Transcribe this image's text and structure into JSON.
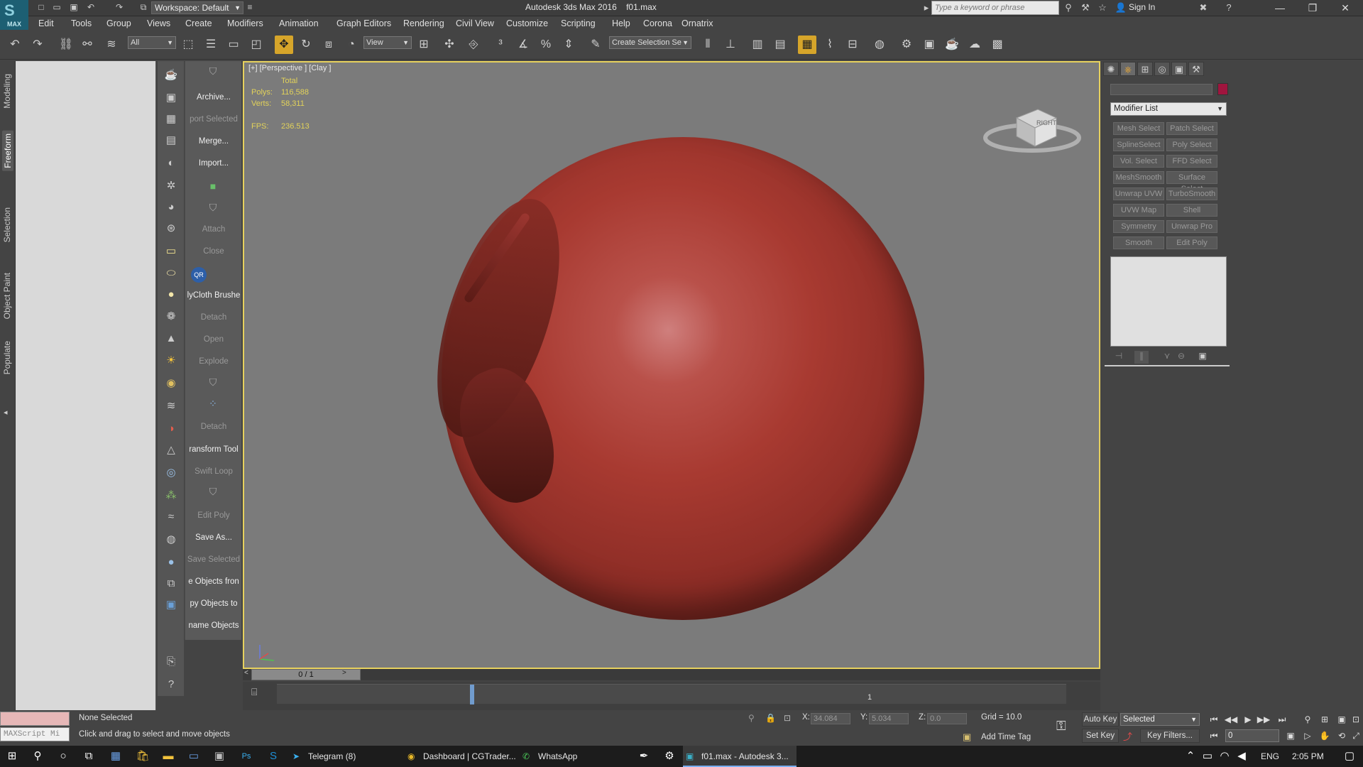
{
  "app": {
    "title": "Autodesk 3ds Max 2016",
    "file": "f01.max",
    "logo_text": "MAX",
    "workspace": "Workspace: Default",
    "search_placeholder": "Type a keyword or phrase",
    "sign_in": "Sign In"
  },
  "menu": [
    "Edit",
    "Tools",
    "Group",
    "Views",
    "Create",
    "Modifiers",
    "Animation",
    "Graph Editors",
    "Rendering",
    "Civil View",
    "Customize",
    "Scripting",
    "Help",
    "Corona",
    "Ornatrix"
  ],
  "toolbar": {
    "selection_filter": "All",
    "reference_coord": "View",
    "selection_set": "Create Selection Se"
  },
  "ribbon_tabs": [
    "Modeling",
    "Freeform",
    "Selection",
    "Object Paint",
    "Populate"
  ],
  "script_panel": [
    {
      "label": "Archive...",
      "dim": false
    },
    {
      "label": "port Selected",
      "dim": true
    },
    {
      "label": "Merge...",
      "dim": false
    },
    {
      "label": "Import...",
      "dim": false
    },
    {
      "label": "Attach",
      "dim": true
    },
    {
      "label": "Close",
      "dim": true
    },
    {
      "label": "lyCloth Brushe",
      "dim": false
    },
    {
      "label": "Detach",
      "dim": true
    },
    {
      "label": "Open",
      "dim": true
    },
    {
      "label": "Explode",
      "dim": true
    },
    {
      "label": "Detach",
      "dim": true
    },
    {
      "label": "ransform Tool",
      "dim": false
    },
    {
      "label": "Swift Loop",
      "dim": true
    },
    {
      "label": "Edit Poly",
      "dim": true
    },
    {
      "label": "Save As...",
      "dim": false
    },
    {
      "label": "Save Selected",
      "dim": true
    },
    {
      "label": "e Objects fron",
      "dim": false
    },
    {
      "label": "py Objects to",
      "dim": false
    },
    {
      "label": "name Objects",
      "dim": false
    }
  ],
  "viewport": {
    "label": "[+] [Perspective ] [Clay ]",
    "stats": {
      "total_label": "Total",
      "polys_label": "Polys:",
      "polys": "116,588",
      "verts_label": "Verts:",
      "verts": "58,311",
      "fps_label": "FPS:",
      "fps": "236.513"
    },
    "viewcube_label": "RIGHT",
    "object_color": "#a83a31"
  },
  "timeline": {
    "frame_display": "0 / 1",
    "track_tick": "1"
  },
  "command_panel": {
    "modifier_list": "Modifier List",
    "color_swatch": "#a0153e",
    "modifier_buttons": [
      [
        "Mesh Select",
        "Patch Select"
      ],
      [
        "SplineSelect",
        "Poly Select"
      ],
      [
        "Vol. Select",
        "FFD Select"
      ],
      [
        "MeshSmooth",
        "Surface Select"
      ],
      [
        "Unwrap UVW",
        "TurboSmooth"
      ],
      [
        "UVW Map",
        "Shell"
      ],
      [
        "Symmetry",
        "Unwrap Pro"
      ],
      [
        "Smooth",
        "Edit Poly"
      ]
    ]
  },
  "status": {
    "maxscript": "MAXScript Mi",
    "selection": "None Selected",
    "prompt": "Click and drag to select and move objects",
    "x_label": "X:",
    "x": "34.084",
    "y_label": "Y:",
    "y": "5.034",
    "z_label": "Z:",
    "z": "0.0",
    "grid": "Grid = 10.0",
    "add_time_tag": "Add Time Tag",
    "auto_key": "Auto Key",
    "set_key": "Set Key",
    "key_mode": "Selected",
    "key_filters": "Key Filters...",
    "current_frame": "0"
  },
  "taskbar": {
    "items": [
      "Telegram (8)",
      "Dashboard | CGTrader...",
      "WhatsApp",
      "f01.max - Autodesk 3..."
    ],
    "lang": "ENG",
    "time": "2:05 PM"
  }
}
